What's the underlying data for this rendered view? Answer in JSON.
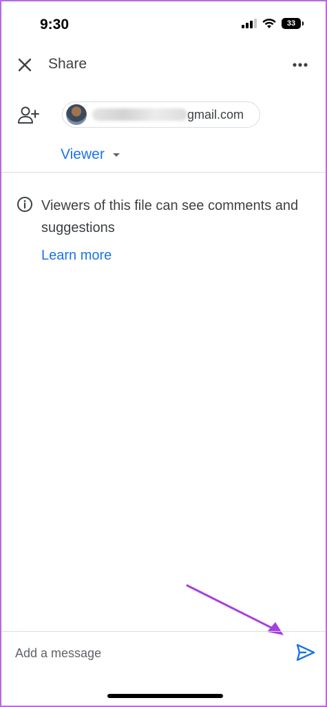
{
  "status_bar": {
    "time": "9:30",
    "battery_level": "33",
    "signal_bars_active": 3,
    "icons": [
      "signal-icon",
      "wifi-icon",
      "battery-icon"
    ]
  },
  "header": {
    "title": "Share",
    "close_icon": "close-icon",
    "more_icon": "more-horizontal-icon"
  },
  "recipient": {
    "email_visible_part": "gmail.com",
    "add_person_icon": "add-person-icon"
  },
  "role": {
    "selected": "Viewer"
  },
  "info": {
    "text": "Viewers of this file can see comments and suggestions",
    "link": "Learn more",
    "icon": "info-icon"
  },
  "message": {
    "placeholder": "Add a message",
    "value": "",
    "send_icon": "send-icon"
  },
  "colors": {
    "accent": "#1a73e8",
    "annotation_arrow": "#a63fe0",
    "frame_border": "#b86ad9"
  }
}
